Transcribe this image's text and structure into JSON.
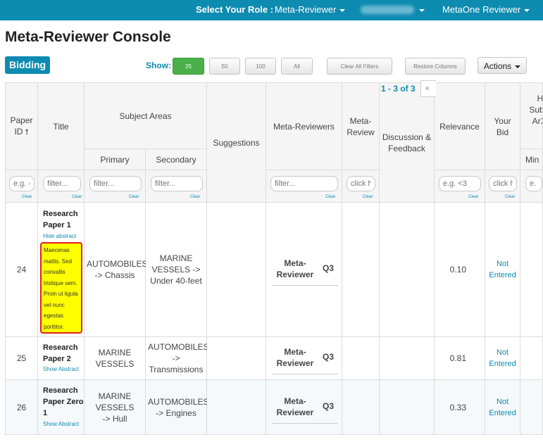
{
  "topbar": {
    "role_label": "Select Your Role :",
    "role_value": "Meta-Reviewer",
    "user_menu": "MetaOne Reviewer"
  },
  "page": {
    "title": "Meta-Reviewer Console",
    "badge": "Bidding"
  },
  "toolbar": {
    "show_label": "Show:",
    "show_options": [
      "25",
      "50",
      "100",
      "All"
    ],
    "clear_filters": "Clear All Filters",
    "restore_columns": "Restore Columns",
    "actions": "Actions"
  },
  "pager": {
    "summary": "1 - 3 of 3",
    "first": "«"
  },
  "headers": {
    "paper_id": "Paper ID",
    "title": "Title",
    "subject_areas": "Subject Areas",
    "primary": "Primary",
    "secondary": "Secondary",
    "suggestions": "Suggestions",
    "meta_reviewers": "Meta-Reviewers",
    "meta_review": "Meta-Review",
    "discussion": "Discussion & Feedback",
    "relevance": "Relevance",
    "your_bid": "Your Bid",
    "arxiv": "H Subm ArXi",
    "min": "Min"
  },
  "filters": {
    "paper_id": "e.g. -",
    "title": "filter...",
    "primary": "filter...",
    "secondary": "filter...",
    "meta_reviewers": "filter...",
    "meta_review": "click h",
    "relevance": "e.g. <3",
    "your_bid": "click h",
    "arxiv": "e.",
    "clear": "Clear"
  },
  "rows": [
    {
      "id": "24",
      "title": "Research Paper 1",
      "abstract_link": "Hide abstract",
      "abstract": "Maecenas mattis. Sed convallis tristique sem. Proin ut ligula vel nunc egestas porttitor.",
      "primary": "AUTOMOBILES -> Chassis",
      "secondary": "MARINE VESSELS -> Under 40-feet",
      "meta_reviewer": "Meta-Reviewer",
      "quartile": "Q3",
      "relevance": "0.10",
      "bid": "Not Entered"
    },
    {
      "id": "25",
      "title": "Research Paper 2",
      "abstract_link": "Show Abstract",
      "primary": "MARINE VESSELS",
      "secondary": "AUTOMOBILES -> Transmissions",
      "meta_reviewer": "Meta-Reviewer",
      "quartile": "Q3",
      "relevance": "0.81",
      "bid": "Not Entered"
    },
    {
      "id": "26",
      "title": "Research Paper Zero 1",
      "abstract_link": "Show Abstract",
      "primary": "MARINE VESSELS -> Hull",
      "secondary": "AUTOMOBILES -> Engines",
      "meta_reviewer": "Meta-Reviewer",
      "quartile": "Q3",
      "relevance": "0.33",
      "bid": "Not Entered"
    }
  ],
  "colors": {
    "accent": "#0e8bb0",
    "active_button": "#4ab04a",
    "highlight": "#ffff00",
    "highlight_border": "#e02020"
  }
}
